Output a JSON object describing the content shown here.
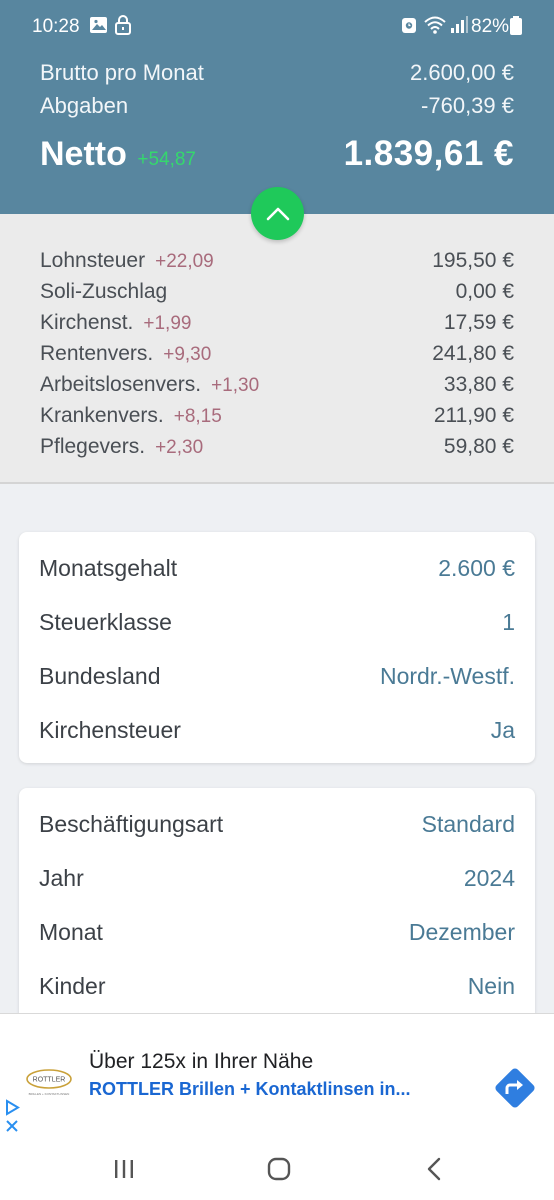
{
  "status_bar": {
    "time": "10:28",
    "battery": "82%",
    "icons": [
      "image-icon",
      "lock-icon",
      "alarm-icon",
      "wifi-icon",
      "signal-icon",
      "battery-icon"
    ]
  },
  "summary": {
    "brutto_label": "Brutto pro Monat",
    "brutto_value": "2.600,00 €",
    "abgaben_label": "Abgaben",
    "abgaben_value": "-760,39 €",
    "netto_label": "Netto",
    "netto_diff": "+54,87",
    "netto_value": "1.839,61 €"
  },
  "collapse_button": {
    "icon": "chevron-up-icon"
  },
  "deductions": [
    {
      "label": "Lohnsteuer",
      "diff": "+22,09",
      "value": "195,50 €"
    },
    {
      "label": "Soli-Zuschlag",
      "diff": "",
      "value": "0,00 €"
    },
    {
      "label": "Kirchenst.",
      "diff": "+1,99",
      "value": "17,59 €"
    },
    {
      "label": "Rentenvers.",
      "diff": "+9,30",
      "value": "241,80 €"
    },
    {
      "label": "Arbeitslosenvers.",
      "diff": "+1,30",
      "value": "33,80 €"
    },
    {
      "label": "Krankenvers.",
      "diff": "+8,15",
      "value": "211,90 €"
    },
    {
      "label": "Pflegevers.",
      "diff": "+2,30",
      "value": "59,80 €"
    }
  ],
  "card1": [
    {
      "label": "Monatsgehalt",
      "value": "2.600 €"
    },
    {
      "label": "Steuerklasse",
      "value": "1"
    },
    {
      "label": "Bundesland",
      "value": "Nordr.-Westf."
    },
    {
      "label": "Kirchensteuer",
      "value": "Ja"
    }
  ],
  "card2": [
    {
      "label": "Beschäftigungsart",
      "value": "Standard"
    },
    {
      "label": "Jahr",
      "value": "2024"
    },
    {
      "label": "Monat",
      "value": "Dezember"
    },
    {
      "label": "Kinder",
      "value": "Nein"
    }
  ],
  "ad": {
    "title": "Über 125x in Ihrer Nähe",
    "subtitle": "ROTTLER Brillen + Kontaktlinsen in...",
    "logo_text": "ROTTLER",
    "logo_subtext": "BRILLEN + KONTAKTLINSEN"
  },
  "colors": {
    "header": "#58869f",
    "accent_green": "#1fc95a",
    "diff_red": "#a86b7c",
    "value_blue": "#4a7a95",
    "ad_blue": "#1a67d2"
  }
}
